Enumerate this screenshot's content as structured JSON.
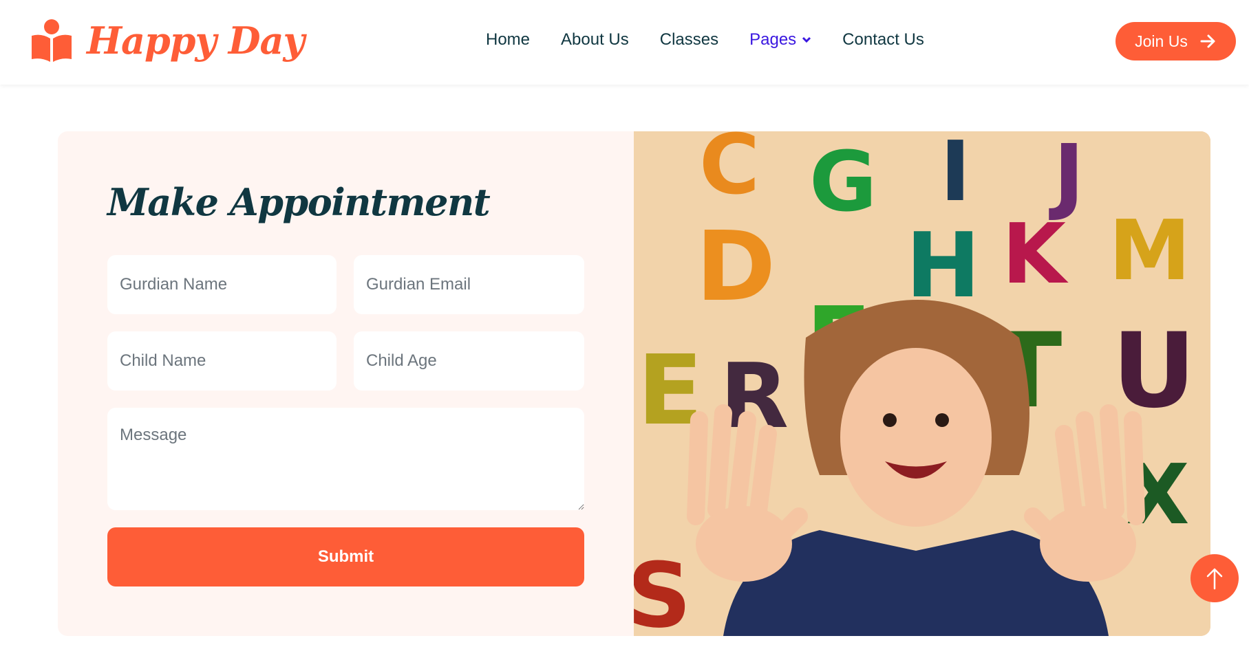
{
  "brand": {
    "name": "Happy Day",
    "color": "#fe5d37"
  },
  "nav": {
    "items": [
      {
        "label": "Home"
      },
      {
        "label": "About Us"
      },
      {
        "label": "Classes"
      },
      {
        "label": "Pages"
      },
      {
        "label": "Contact Us"
      }
    ],
    "active": "Pages",
    "join_label": "Join Us"
  },
  "form": {
    "title": "Make Appointment",
    "guardian_name_placeholder": "Gurdian Name",
    "guardian_email_placeholder": "Gurdian Email",
    "child_name_placeholder": "Child Name",
    "child_age_placeholder": "Child Age",
    "message_placeholder": "Message",
    "submit_label": "Submit"
  },
  "image": {
    "letters": [
      "C",
      "G",
      "I",
      "J",
      "D",
      "H",
      "K",
      "M",
      "F",
      "E",
      "R",
      "T",
      "U",
      "X",
      "S"
    ]
  },
  "colors": {
    "accent": "#fe5d37",
    "heading": "#103741",
    "nav_active": "#3a17e0",
    "form_bg": "#fff5f2"
  }
}
